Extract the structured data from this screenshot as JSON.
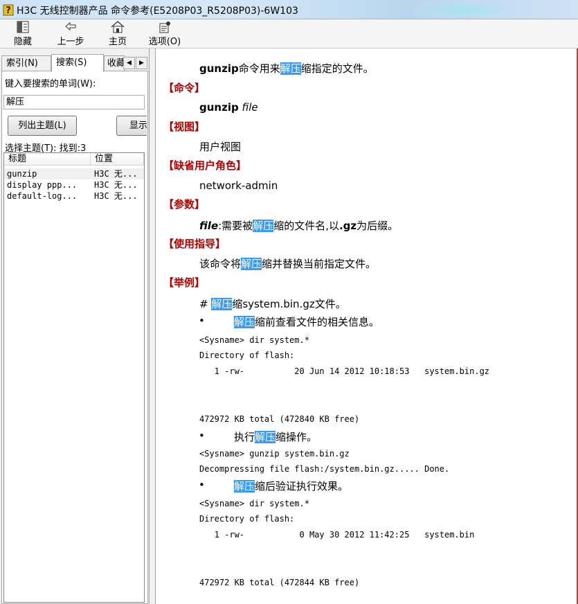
{
  "window": {
    "title": "H3C 无线控制器产品 命令参考(E5208P03_R5208P03)-6W103"
  },
  "toolbar": {
    "hide_label": "隐藏",
    "back_label": "上一步",
    "home_label": "主页",
    "options_label": "选项(O)"
  },
  "tabs": {
    "index": "索引(N)",
    "search": "搜索(S)",
    "favorites": "收藏"
  },
  "search": {
    "prompt": "键入要搜索的单词(W):",
    "value": "解压",
    "list_button": "列出主题(L)",
    "display_button": "显示",
    "select_label": "选择主题(T): 找到:3",
    "columns": [
      "标题",
      "位置"
    ],
    "results": [
      {
        "title": "gunzip",
        "location": "H3C 无..."
      },
      {
        "title": "display ppp...",
        "location": "H3C 无..."
      },
      {
        "title": "default-log...",
        "location": "H3C 无..."
      }
    ]
  },
  "content": {
    "intro": {
      "cmd": "gunzip",
      "pre": "命令用来",
      "hl": "解压",
      "post": "缩指定的文件。"
    },
    "sections": {
      "command": "【命令】",
      "view": "【视图】",
      "role": "【缺省用户角色】",
      "params": "【参数】",
      "usage": "【使用指导】",
      "example": "【举例】"
    },
    "command_syntax": {
      "cmd": "gunzip",
      "arg": "file"
    },
    "view_value": "用户视图",
    "role_value": "network-admin",
    "param": {
      "name": "file",
      "pre": ":需要被",
      "hl": "解压",
      "mid": "缩的文件名,以",
      "ext": ".gz",
      "post": "为后缀。"
    },
    "usage": {
      "pre": "该命令将",
      "hl": "解压",
      "post": "缩并替换当前指定文件。"
    },
    "example_title": {
      "pre": "# ",
      "hl": "解压",
      "post": "缩system.bin.gz文件。"
    },
    "step1": {
      "hl": "解压",
      "post": "缩前查看文件的相关信息。"
    },
    "code1": [
      "<Sysname> dir system.*",
      "Directory of flash:",
      "   1 -rw-          20 Jun 14 2012 10:18:53   system.bin.gz",
      "472972 KB total (472840 KB free)"
    ],
    "step2": {
      "pre": "执行",
      "hl": "解压",
      "post": "缩操作。"
    },
    "code2": [
      "<Sysname> gunzip system.bin.gz",
      "Decompressing file flash:/system.bin.gz..... Done."
    ],
    "step3": {
      "hl": "解压",
      "post": "缩后验证执行效果。"
    },
    "code3": [
      "<Sysname> dir system.*",
      "Directory of flash:",
      "   1 -rw-           0 May 30 2012 11:42:25   system.bin",
      "472972 KB total (472844 KB free)"
    ],
    "bullet": "•"
  }
}
